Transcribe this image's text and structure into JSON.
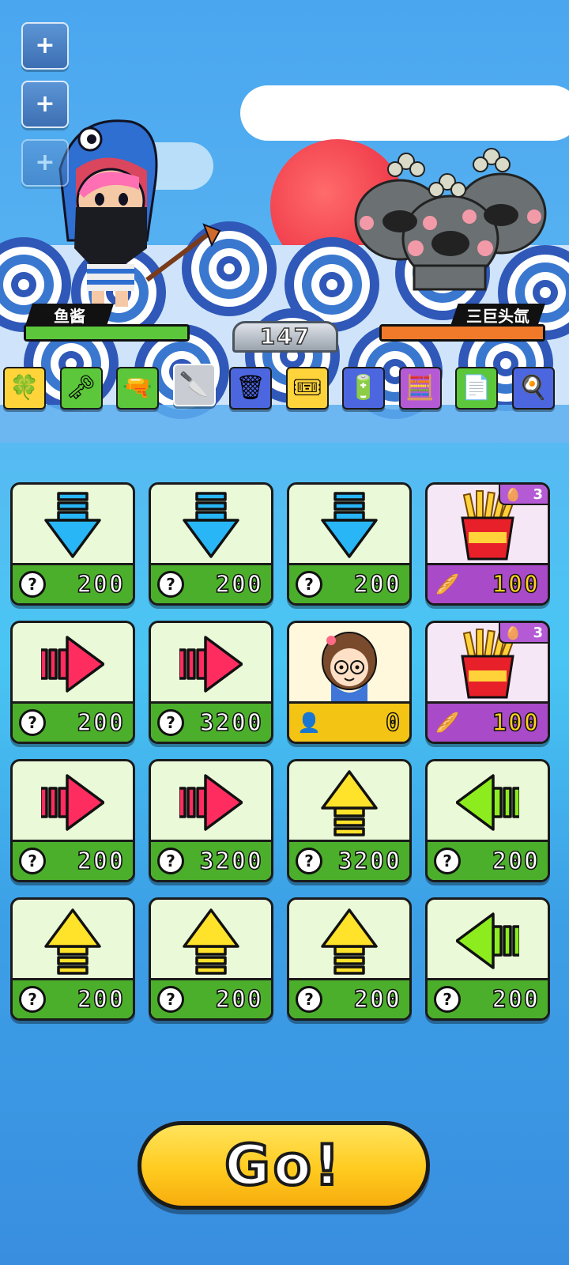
{
  "player": {
    "name": "鱼酱",
    "hp_fraction": 1.0,
    "hp_color": "#5cc73a"
  },
  "enemy": {
    "name": "三巨头氙",
    "hp_fraction": 1.0,
    "hp_color": "#f07a2a"
  },
  "score": "147",
  "side_buttons": [
    {
      "icon": "plus-icon",
      "label": "+"
    },
    {
      "icon": "plus-icon",
      "label": "+"
    },
    {
      "icon": "plus-icon",
      "label": "+",
      "disabled": true
    }
  ],
  "items": [
    {
      "icon": "clover-icon",
      "glyph": "🍀",
      "color": "#ffd43b"
    },
    {
      "icon": "key-icon",
      "glyph": "🗝",
      "color": "#5cc73a"
    },
    {
      "icon": "gun-icon",
      "glyph": "🔫",
      "color": "#5cc73a"
    },
    {
      "icon": "cleaver-icon",
      "glyph": "🔪",
      "color": "#c9cdd3",
      "selected": true
    },
    {
      "icon": "trash-can-icon",
      "glyph": "🗑",
      "color": "#4c66e0"
    },
    {
      "icon": "ticket-icon",
      "glyph": "🎟",
      "color": "#ffd43b"
    },
    {
      "icon": "battery-icon",
      "glyph": "🔋",
      "color": "#4c66e0"
    },
    {
      "icon": "calculator-icon",
      "glyph": "🧮",
      "color": "#b45ad4"
    },
    {
      "icon": "document-icon",
      "glyph": "📄",
      "color": "#5cc73a"
    },
    {
      "icon": "frying-pan-icon",
      "glyph": "🍳",
      "color": "#4c66e0"
    }
  ],
  "cards": [
    {
      "art": "arrow-down",
      "cost_icon": "question",
      "price": "200"
    },
    {
      "art": "arrow-down",
      "cost_icon": "question",
      "price": "200"
    },
    {
      "art": "arrow-down",
      "cost_icon": "question",
      "price": "200"
    },
    {
      "art": "fries",
      "cost_icon": "bread",
      "price": "100",
      "style": "purple",
      "badge": "3"
    },
    {
      "art": "arrow-right",
      "cost_icon": "question",
      "price": "200"
    },
    {
      "art": "arrow-right",
      "cost_icon": "question",
      "price": "3200"
    },
    {
      "art": "girl-portrait",
      "cost_icon": "person",
      "price": "0",
      "style": "gold"
    },
    {
      "art": "fries",
      "cost_icon": "bread",
      "price": "100",
      "style": "purple",
      "badge": "3"
    },
    {
      "art": "arrow-right",
      "cost_icon": "question",
      "price": "200"
    },
    {
      "art": "arrow-right",
      "cost_icon": "question",
      "price": "3200"
    },
    {
      "art": "arrow-up",
      "cost_icon": "question",
      "price": "3200"
    },
    {
      "art": "arrow-left",
      "cost_icon": "question",
      "price": "200"
    },
    {
      "art": "arrow-up",
      "cost_icon": "question",
      "price": "200"
    },
    {
      "art": "arrow-up",
      "cost_icon": "question",
      "price": "200"
    },
    {
      "art": "arrow-up",
      "cost_icon": "question",
      "price": "200"
    },
    {
      "art": "arrow-left",
      "cost_icon": "question",
      "price": "200"
    }
  ],
  "go_button": {
    "label": "Go!"
  }
}
